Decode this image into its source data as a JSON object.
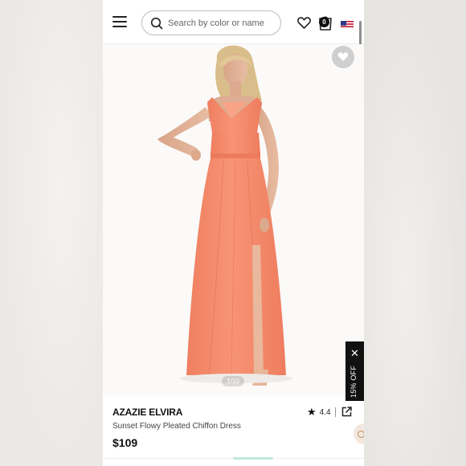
{
  "header": {
    "search_placeholder": "Search by color or name",
    "bag_count": "0"
  },
  "gallery": {
    "counter": "1/10"
  },
  "promo": {
    "label": "15% OFF",
    "close": "✕"
  },
  "product": {
    "brand": "AZAZIE ELVIRA",
    "name": "Sunset Flowy Pleated Chiffon Dress",
    "price": "$109",
    "rating": "4.4"
  },
  "colors": {
    "dress": "#f58a6a",
    "accent": "#111111"
  },
  "icons": [
    "menu-icon",
    "search-icon",
    "heart-icon",
    "bag-icon",
    "us-flag-icon",
    "favorite-heart-icon",
    "star-icon",
    "share-icon",
    "close-icon",
    "chat-icon"
  ]
}
